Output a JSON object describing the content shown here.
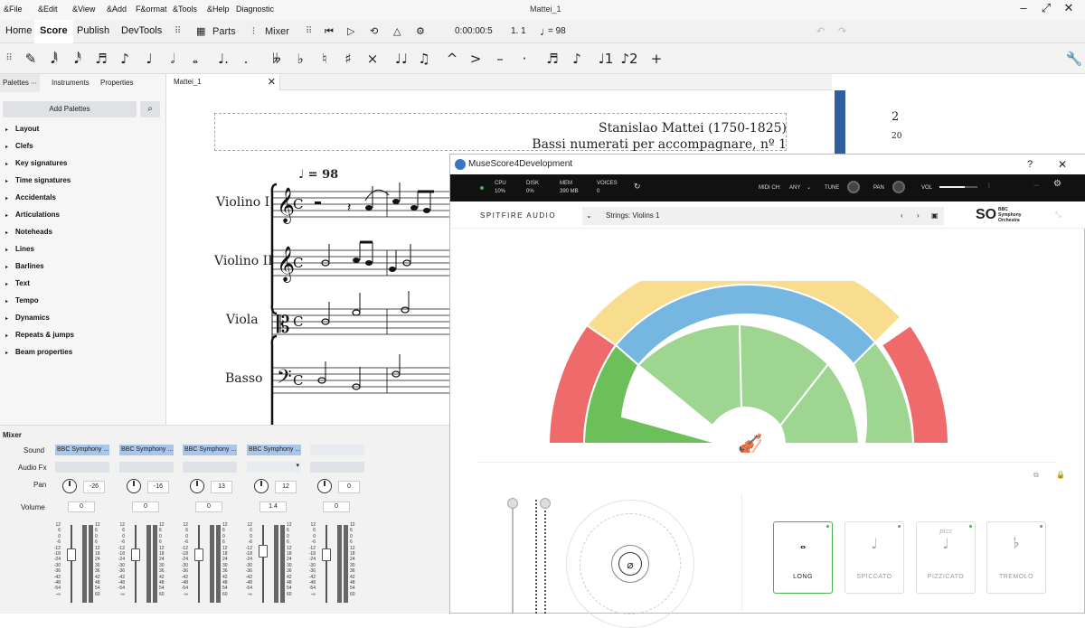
{
  "menubar": {
    "items": [
      "&File",
      "&Edit",
      "&View",
      "&Add",
      "F&ormat",
      "&Tools",
      "&Help",
      "Diagnostic"
    ],
    "window_title": "Mattei_1"
  },
  "toolbar": {
    "workspace_tabs": [
      "Home",
      "Score",
      "Publish",
      "DevTools"
    ],
    "active_tab": "Score",
    "parts_label": "Parts",
    "mixer_label": "Mixer",
    "time": "0:00:00:5",
    "position": "1. 1",
    "tempo_note": "♩",
    "tempo": "= 98"
  },
  "palettes": {
    "tabs": [
      "Palettes",
      "Instruments",
      "Properties"
    ],
    "add_button": "Add Palettes",
    "items": [
      "Layout",
      "Clefs",
      "Key signatures",
      "Time signatures",
      "Accidentals",
      "Articulations",
      "Noteheads",
      "Lines",
      "Barlines",
      "Text",
      "Tempo",
      "Dynamics",
      "Repeats & jumps",
      "Beam properties"
    ]
  },
  "score": {
    "tab_label": "Mattei_1",
    "composer": "Stanislao Mattei (1750-1825)",
    "subtitle": "Bassi numerati per accompagnare, nº 1",
    "tempo_mark": "= 98",
    "instruments": [
      "Violino I",
      "Violino II",
      "Viola",
      "Basso"
    ],
    "measure_number": "2",
    "page_number": "20"
  },
  "mixer": {
    "title": "Mixer",
    "labels": {
      "sound": "Sound",
      "audio_fx": "Audio Fx",
      "pan": "Pan",
      "volume": "Volume"
    },
    "channels": [
      {
        "sound": "BBC Symphony ...",
        "pan": "-26",
        "volume": "0"
      },
      {
        "sound": "BBC Symphony ...",
        "pan": "-16",
        "volume": "0"
      },
      {
        "sound": "BBC Symphony ...",
        "pan": "13",
        "volume": "0"
      },
      {
        "sound": "BBC Symphony ...",
        "pan": "12",
        "volume": "1.4"
      },
      {
        "sound": "",
        "pan": "0",
        "volume": "0"
      }
    ],
    "scale": [
      "12",
      "6",
      "0",
      "-6",
      "-12",
      "-18",
      "-24",
      "-30",
      "-36",
      "-42",
      "-48",
      "-54",
      "-∞"
    ],
    "meter_scale": [
      "12",
      "6",
      "0",
      "6",
      "12",
      "18",
      "24",
      "30",
      "36",
      "42",
      "48",
      "54",
      "60"
    ]
  },
  "plugin": {
    "window_title": "MuseScore4Development",
    "header": {
      "cpu_label": "CPU",
      "cpu": "10%",
      "disk_label": "DISK",
      "disk": "0%",
      "mem_label": "MEM",
      "mem": "390 MB",
      "voices_label": "VOICES",
      "voices": "0",
      "midi_label": "MIDI CH:",
      "midi": "ANY",
      "tune": "TUNE",
      "pan": "PAN",
      "vol": "VOL"
    },
    "brand": "SPITFIRE AUDIO",
    "preset": "Strings: Violins 1",
    "logo_main": "SO",
    "logo_lines": [
      "BBC",
      "Symphony",
      "Orchestra"
    ],
    "articulations": [
      {
        "label": "LONG",
        "icon": "whole-note-icon"
      },
      {
        "label": "SPICCATO",
        "icon": "spiccato-icon"
      },
      {
        "label": "PIZZICATO",
        "icon": "pizzicato-icon",
        "sublabel": "pizz"
      },
      {
        "label": "TREMOLO",
        "icon": "tremolo-icon"
      }
    ],
    "selected_articulation": "LONG",
    "colors": {
      "green": "#79c35a",
      "blue": "#76b7e2",
      "yellow": "#f8dd8f",
      "red": "#ef6a6a"
    }
  }
}
